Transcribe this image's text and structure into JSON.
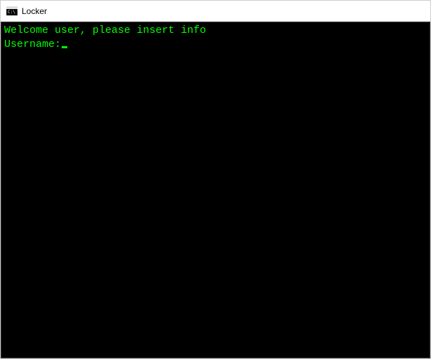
{
  "window": {
    "title": "Locker"
  },
  "console": {
    "welcome_line": "Welcome user, please insert info",
    "prompt_label": "Username:",
    "input_value": ""
  }
}
